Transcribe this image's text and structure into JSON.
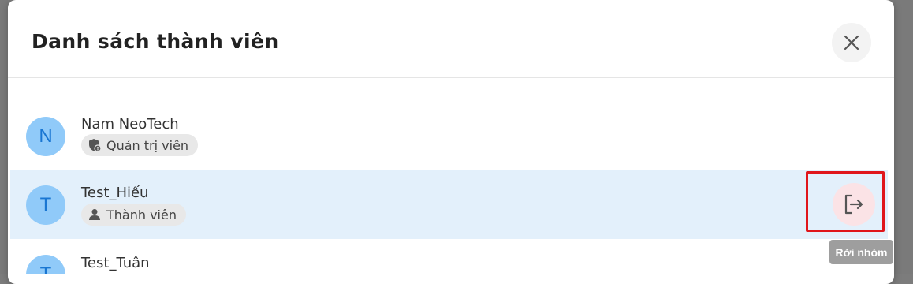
{
  "modal": {
    "title": "Danh sách thành viên",
    "close_icon": "close-icon"
  },
  "members": [
    {
      "initial": "N",
      "name": "Nam NeoTech",
      "role": "Quản trị viên",
      "role_icon": "admin-shield-icon"
    },
    {
      "initial": "T",
      "name": "Test_Hiếu",
      "role": "Thành viên",
      "role_icon": "person-icon",
      "selected": true
    },
    {
      "initial": "T",
      "name": "Test_Tuân"
    }
  ],
  "actions": {
    "leave_icon": "logout-icon",
    "leave_tooltip": "Rời nhóm"
  },
  "colors": {
    "avatar_bg": "#90caf9",
    "avatar_text": "#1976d2",
    "selected_row_bg": "#e3f0fb",
    "leave_button_bg": "#fbe3e6",
    "highlight_border": "#e0161b",
    "tooltip_bg": "#9e9e9e"
  }
}
